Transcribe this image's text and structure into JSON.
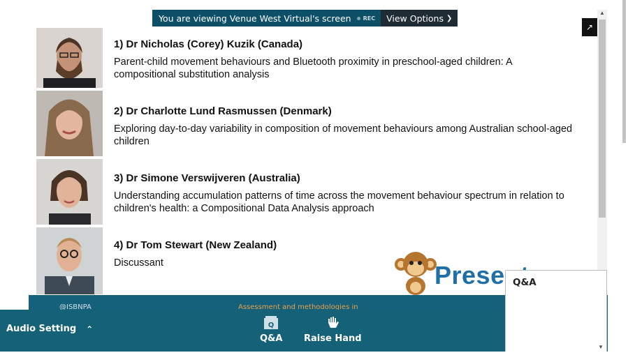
{
  "banner": {
    "message": "You are viewing Venue West Virtual's screen",
    "rec_label": "REC",
    "view_options_label": "View Options"
  },
  "speakers": [
    {
      "name": "1)  Dr Nicholas (Corey) Kuzik (Canada)",
      "description": "Parent-child movement behaviours and Bluetooth proximity in preschool-aged children: A compositional substitution analysis"
    },
    {
      "name": "2) Dr Charlotte Lund Rasmussen (Denmark)",
      "description": "Exploring day-to-day variability in composition of movement behaviours among Australian school-aged children"
    },
    {
      "name": "3) Dr Simone Verswijveren (Australia)",
      "description": "Understanding accumulation patterns of time across the movement behaviour spectrum in relation to children's health: a Compositional Data Analysis approach"
    },
    {
      "name": "4) Dr Tom Stewart (New Zealand)",
      "description": "Discussant"
    }
  ],
  "watermark": {
    "brand_text": "Present"
  },
  "slide_footer": {
    "logo_text": "@ISBNPA",
    "title_text": "Assessment and methodologies in"
  },
  "toolbar": {
    "audio_setting_label": "Audio Setting",
    "qa_label": "Q&A",
    "raise_hand_label": "Raise Hand"
  },
  "qa_panel": {
    "title": "Q&A"
  },
  "colors": {
    "toolbar_bg": "#156178",
    "banner_bg": "#0d4f66",
    "brand_blue": "#1f6fa8"
  }
}
